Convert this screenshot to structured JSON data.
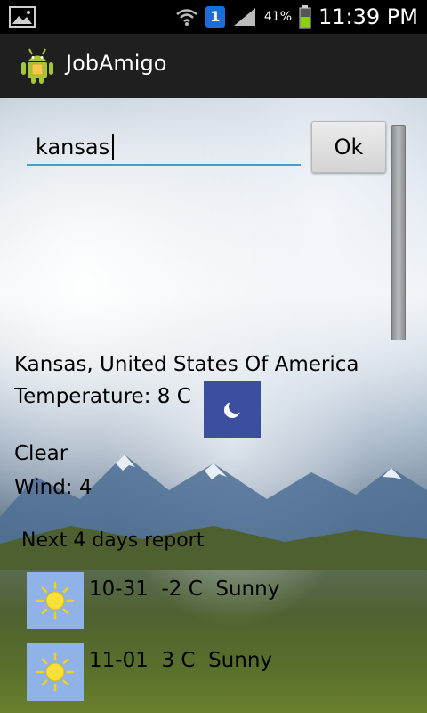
{
  "status_bar": {
    "time": "11:39 PM",
    "battery_percent": "41%",
    "sim_badge": "1",
    "icons": [
      "image-notification-icon",
      "wifi-icon",
      "sim-icon",
      "signal-icon",
      "battery-icon"
    ]
  },
  "action_bar": {
    "title": "JobAmigo",
    "icon": "android-app-icon"
  },
  "search": {
    "value": "kansas",
    "button_label": "Ok"
  },
  "weather": {
    "location": "Kansas, United States Of America",
    "temperature": "Temperature: 8 C",
    "condition": "Clear",
    "wind": "Wind: 4",
    "condition_icon": "moon-icon"
  },
  "forecast": {
    "heading": "Next 4 days report",
    "days": [
      {
        "text": "10-31  -2 C  Sunny",
        "icon": "sun-icon"
      },
      {
        "text": "11-01  3 C  Sunny",
        "icon": "sun-icon"
      }
    ]
  },
  "colors": {
    "accent": "#3aa2d0",
    "moon_tile": "#3b4ea0",
    "sun_tile": "#8fb3e6",
    "battery": "#8cd100"
  }
}
